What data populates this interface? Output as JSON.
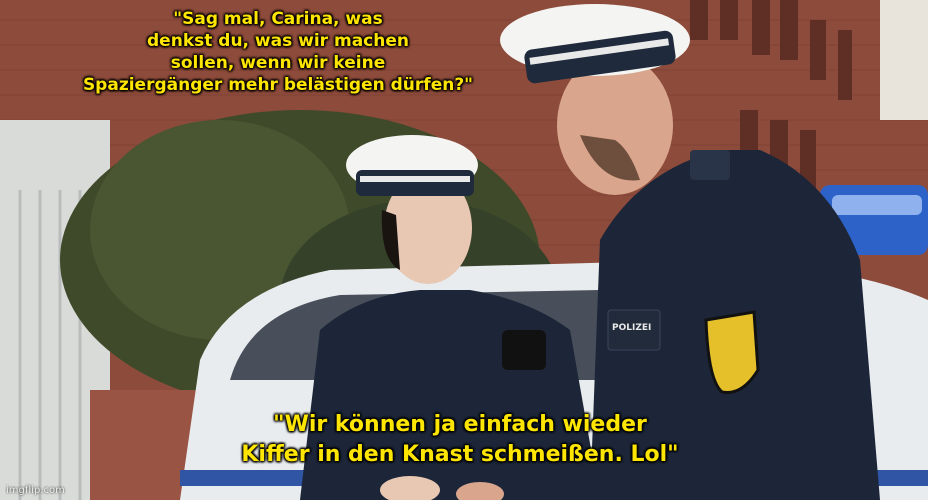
{
  "meme": {
    "top_caption": "\"Sag mal, Carina, was\ndenkst du, was wir machen\nsollen, wenn wir keine\nSpaziergänger mehr belästigen dürfen?\"",
    "bottom_caption": "\"Wir können ja einfach wieder\nKiffer in den Knast schmeißen. Lol\"",
    "watermark": "imgflip.com",
    "badge_text": "POLIZEI"
  },
  "colors": {
    "caption": "#ffe600",
    "uniform": "#1c2638",
    "brick": "#8a4a3a"
  }
}
